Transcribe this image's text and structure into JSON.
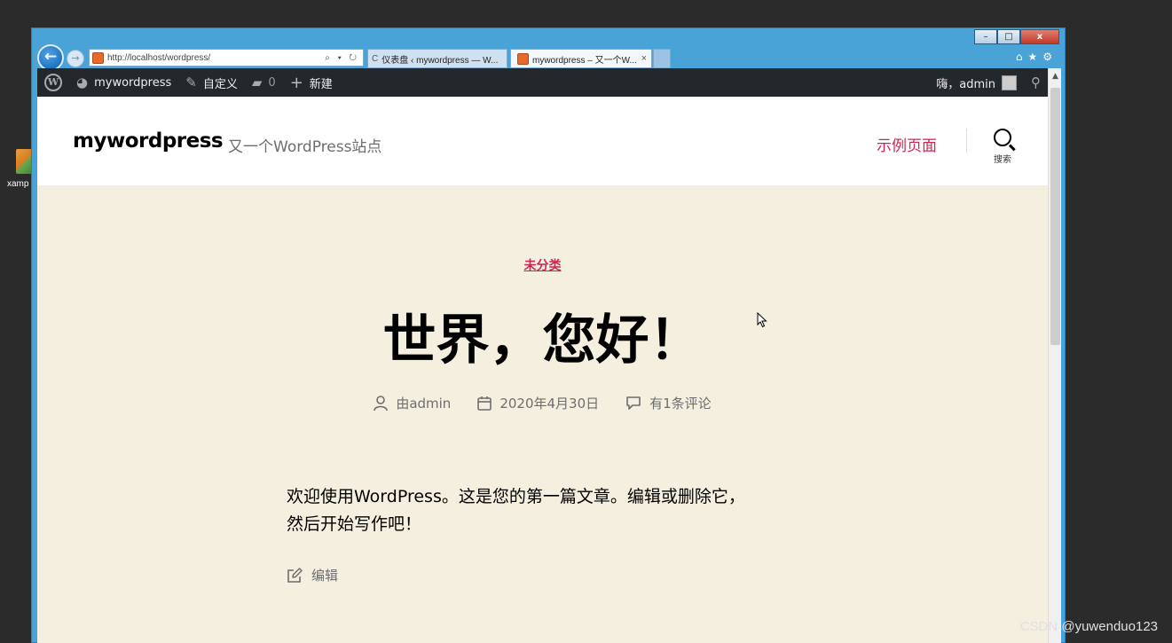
{
  "desktop": {
    "icon_label": "xamp"
  },
  "window": {
    "controls": [
      "–",
      "□",
      "x"
    ]
  },
  "browser": {
    "address": "http://localhost/wordpress/",
    "address_tools": "⌕ ▾ ↻",
    "tabs": [
      {
        "label": "仪表盘 ‹ mywordpress — W...",
        "active": false
      },
      {
        "label": "mywordpress – 又一个W...",
        "active": true
      }
    ],
    "tab_close": "×",
    "toolbar_icons": [
      "home-icon",
      "star-icon",
      "gear-icon"
    ]
  },
  "admin_bar": {
    "site_name": "mywordpress",
    "customize": "自定义",
    "comments_count": "0",
    "new": "新建",
    "greeting": "嗨，admin"
  },
  "site": {
    "title": "mywordpress",
    "description": "又一个WordPress站点",
    "menu_item": "示例页面",
    "search_label": "搜索"
  },
  "post": {
    "category": "未分类",
    "title": "世界，您好！",
    "author": "由admin",
    "date": "2020年4月30日",
    "comments": "有1条评论",
    "body_line1": "欢迎使用WordPress。这是您的第一篇文章。编辑或删除它，",
    "body_line2": "然后开始写作吧！",
    "edit_label": "编辑"
  },
  "watermark": "CSDN @yuwenduo123"
}
